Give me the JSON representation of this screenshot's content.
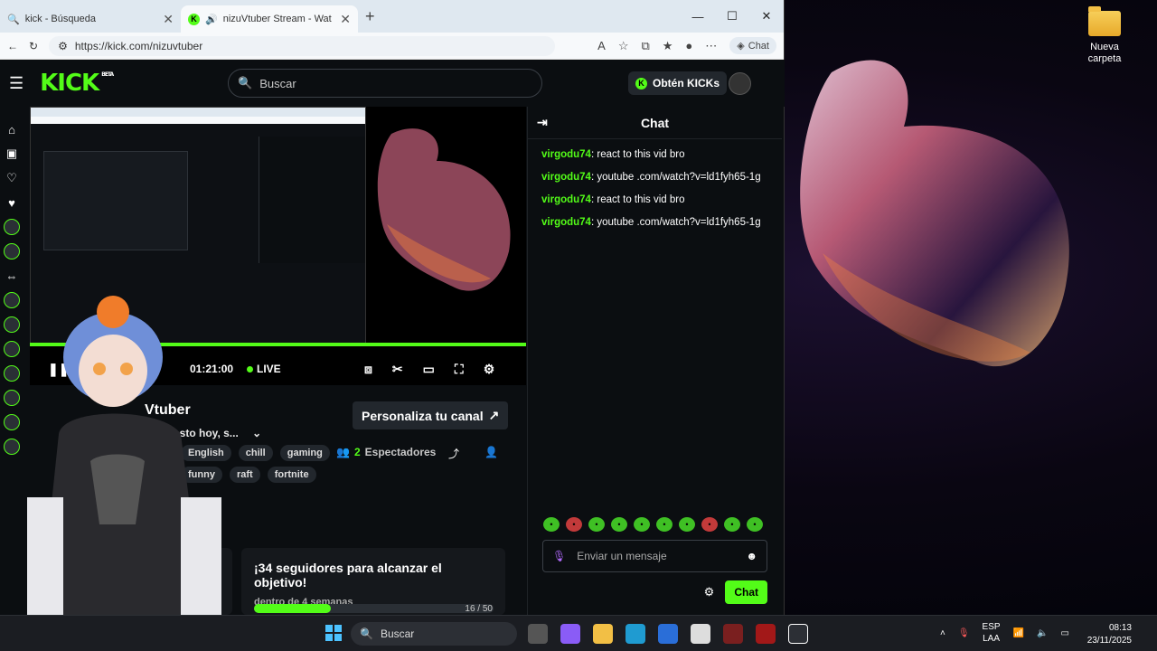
{
  "browser": {
    "tabs": [
      {
        "title": "kick - Búsqueda",
        "close": "✕"
      },
      {
        "title": "nizuVtuber Stream - Watch L",
        "close": "✕"
      }
    ],
    "new_tab": "+",
    "url": "https://kick.com/nizuvtuber",
    "copilot_label": "Chat",
    "win_min": "—",
    "win_max": "☐",
    "win_close": "✕"
  },
  "kick": {
    "logo": "KICK",
    "logo_badge": "BETA",
    "search_placeholder": "Buscar",
    "get_kicks": "Obtén KICKs",
    "player": {
      "time": "01:21:00",
      "live": "LIVE",
      "progress_fraction": 1.0
    },
    "channel": {
      "name": "Vtuber",
      "title": "uen pasto hoy, s...",
      "customize": "Personaliza tu canal",
      "viewers_count": "2",
      "viewers_label": "Espectadores",
      "tags": [
        "English",
        "chill",
        "gaming",
        "funny",
        "raft",
        "fortnite"
      ]
    },
    "goal": {
      "title": "¡34 seguidores para alcanzar el objetivo!",
      "subtitle": "dentro de 4 semanas",
      "count": "16 / 50",
      "fraction": 0.32
    },
    "chat": {
      "header": "Chat",
      "messages": [
        {
          "user": "virgodu74",
          "text": "react to this vid bro"
        },
        {
          "user": "virgodu74",
          "text": "youtube .com/watch?v=ld1fyh65-1g"
        },
        {
          "user": "virgodu74",
          "text": "react to this vid bro"
        },
        {
          "user": "virgodu74",
          "text": "youtube .com/watch?v=ld1fyh65-1g"
        }
      ],
      "input_placeholder": "Enviar un mensaje",
      "send_label": "Chat"
    }
  },
  "desktop": {
    "folder_label": "Nueva carpeta"
  },
  "taskbar": {
    "search": "Buscar",
    "lang_top": "ESP",
    "lang_bottom": "LAA",
    "time": "08:13",
    "date": "23/11/2025"
  },
  "colors": {
    "kick_green": "#53fc18",
    "background": "#0b0e11"
  }
}
